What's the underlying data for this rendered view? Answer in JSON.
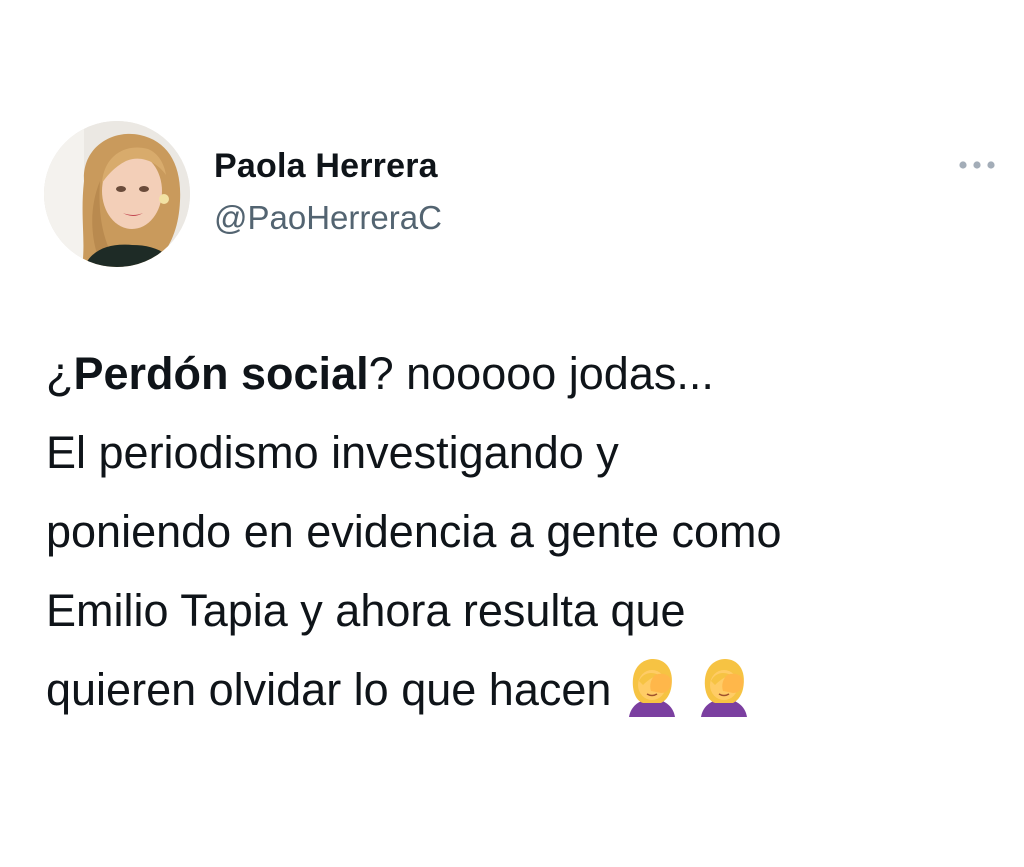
{
  "author": {
    "display_name": "Paola Herrera",
    "handle": "@PaoHerreraC",
    "avatar_icon": "profile-photo"
  },
  "more_icon": "more-horizontal-icon",
  "tweet": {
    "line1_open": "¿",
    "line1_bold": "Perdón social",
    "line1_rest": "? nooooo jodas...",
    "line2": "El periodismo investigando y",
    "line3": "poniendo en evidencia a gente como",
    "line4": "Emilio Tapia y ahora resulta que",
    "line5": "quieren olvidar lo que hacen",
    "emojis": [
      "woman-facepalming-emoji",
      "woman-facepalming-emoji"
    ]
  },
  "colors": {
    "text": "#0f1419",
    "secondary": "#536471",
    "more_dots": "#a3adb8"
  }
}
